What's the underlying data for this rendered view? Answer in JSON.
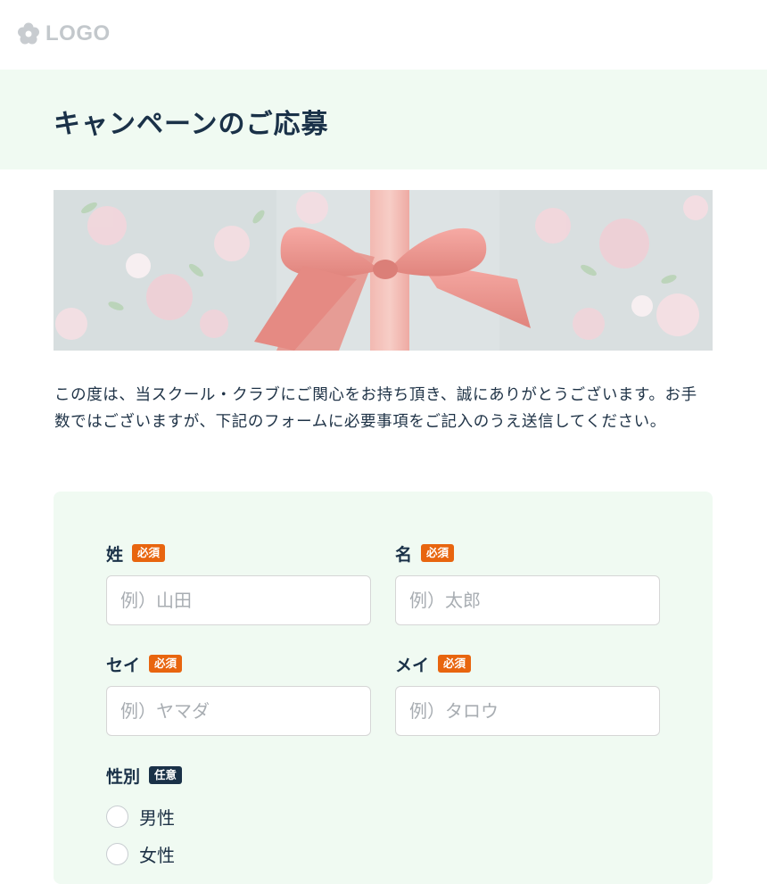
{
  "header": {
    "logo_text": "LOGO"
  },
  "page": {
    "title": "キャンペーンのご応募"
  },
  "intro": {
    "text": "この度は、当スクール・クラブにご関心をお持ち頂き、誠にありがとうございます。お手数ではございますが、下記のフォームに必要事項をご記入のうえ送信してください。"
  },
  "badges": {
    "required": "必須",
    "optional": "任意"
  },
  "form": {
    "last_name": {
      "label": "姓",
      "placeholder": "例）山田",
      "value": ""
    },
    "first_name": {
      "label": "名",
      "placeholder": "例）太郎",
      "value": ""
    },
    "last_name_kana": {
      "label": "セイ",
      "placeholder": "例）ヤマダ",
      "value": ""
    },
    "first_name_kana": {
      "label": "メイ",
      "placeholder": "例）タロウ",
      "value": ""
    },
    "gender": {
      "label": "性別",
      "options": [
        "男性",
        "女性"
      ],
      "selected": null
    }
  },
  "colors": {
    "band": "#f0faf2",
    "required_badge": "#e8650f",
    "optional_badge": "#1a3148",
    "text": "#1a3148"
  },
  "icons": {
    "logo": "flower-logo-icon",
    "hero": "gift-ribbon-image"
  }
}
